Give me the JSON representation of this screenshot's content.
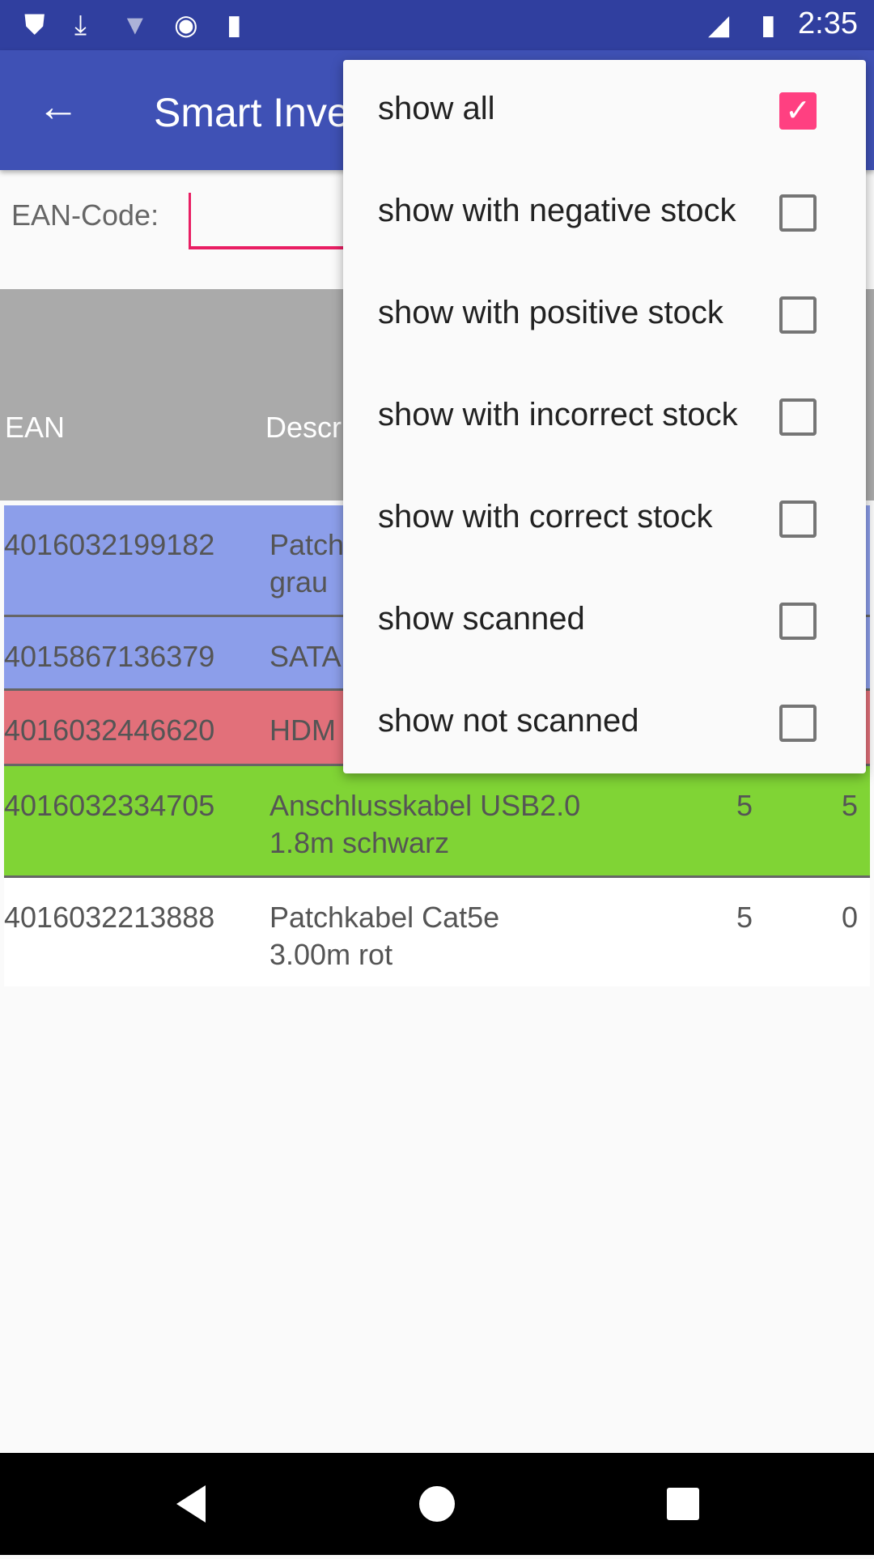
{
  "status_bar": {
    "time": "2:35",
    "icons": [
      "shield-icon",
      "download-icon",
      "wifi-unknown-icon",
      "record-icon",
      "sd-card-icon",
      "lte-signal-icon",
      "battery-charging-icon"
    ]
  },
  "app_bar": {
    "title": "Smart Inve"
  },
  "ean": {
    "label": "EAN-Code:",
    "value": ""
  },
  "table": {
    "headers": [
      "EAN",
      "Descr"
    ],
    "rows": [
      {
        "ean": "4016032199182",
        "desc": "Patch\ngrau",
        "a": "",
        "b": "",
        "color": "#8c9eea"
      },
      {
        "ean": "4015867136379",
        "desc": "SATA",
        "a": "",
        "b": "",
        "color": "#8c9eea"
      },
      {
        "ean": "4016032446620",
        "desc": "HDM",
        "a": "",
        "b": "",
        "color": "#e2707a"
      },
      {
        "ean": "4016032334705",
        "desc": "Anschlusskabel USB2.0\n1.8m schwarz",
        "a": "5",
        "b": "5",
        "color": "#80d435"
      },
      {
        "ean": "4016032213888",
        "desc": "Patchkabel Cat5e\n3.00m rot",
        "a": "5",
        "b": "0",
        "color": "#ffffff"
      }
    ]
  },
  "menu": {
    "items": [
      {
        "label": "show all",
        "checked": true
      },
      {
        "label": "show with negative stock",
        "checked": false
      },
      {
        "label": "show with positive stock",
        "checked": false
      },
      {
        "label": "show with incorrect stock",
        "checked": false
      },
      {
        "label": "show with correct stock",
        "checked": false
      },
      {
        "label": "show scanned",
        "checked": false
      },
      {
        "label": "show not scanned",
        "checked": false
      }
    ]
  },
  "colors": {
    "primary": "#3f51b5",
    "primary_dark": "#303f9f",
    "accent": "#ff4081"
  }
}
